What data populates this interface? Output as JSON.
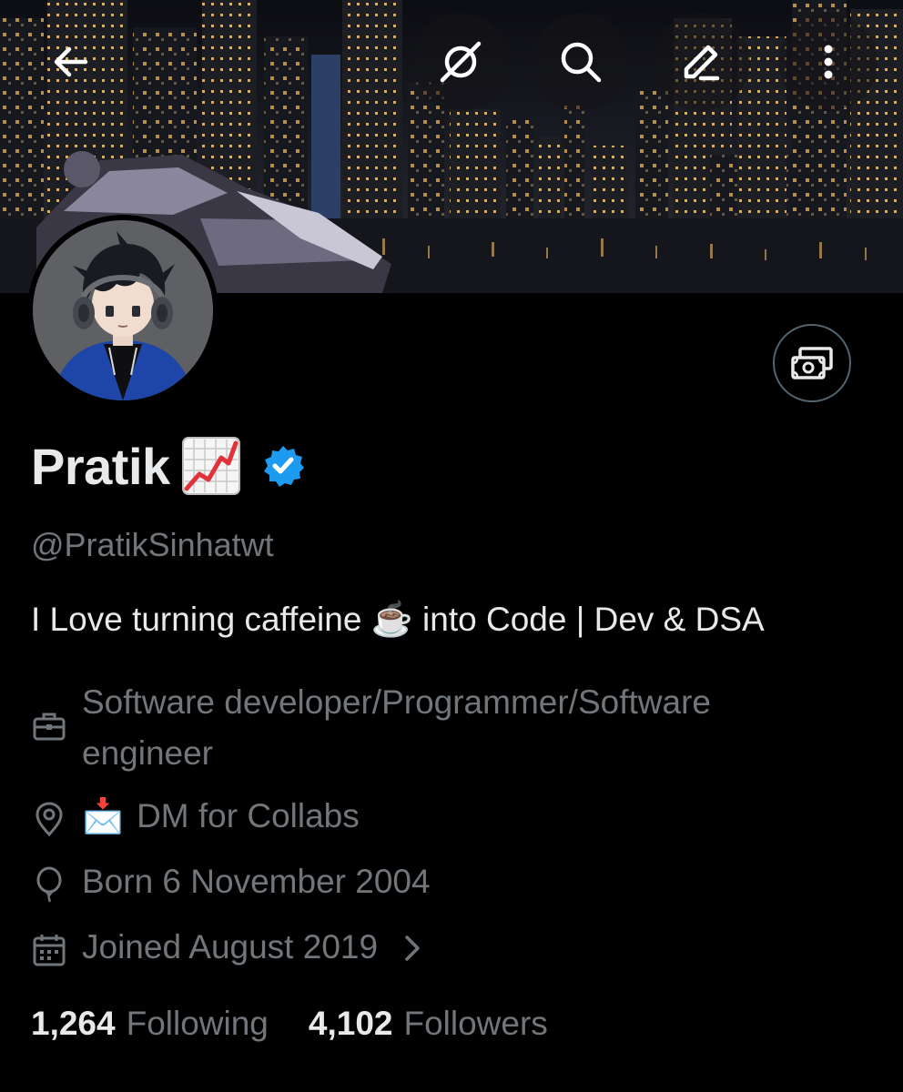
{
  "profile": {
    "display_name": "Pratik",
    "name_emoji": "chart-increasing-emoji",
    "verified": true,
    "handle": "@PratikSinhatwt",
    "bio": "I Love turning caffeine ☕ into Code | Dev & DSA",
    "profession": "Software developer/Programmer/Software engineer",
    "location_emoji": "📩",
    "location": "DM for Collabs",
    "birthday": "Born 6 November 2004",
    "joined": "Joined August 2019",
    "following_count": "1,264",
    "following_label": "Following",
    "followers_count": "4,102",
    "followers_label": "Followers"
  },
  "header": {
    "icons": [
      "back-arrow-icon",
      "grok-icon",
      "search-icon",
      "edit-icon",
      "more-icon"
    ]
  },
  "colors": {
    "background": "#000000",
    "primary_text": "#e7e9ea",
    "secondary_text": "#71767b",
    "verified_blue": "#1d9bf0"
  }
}
